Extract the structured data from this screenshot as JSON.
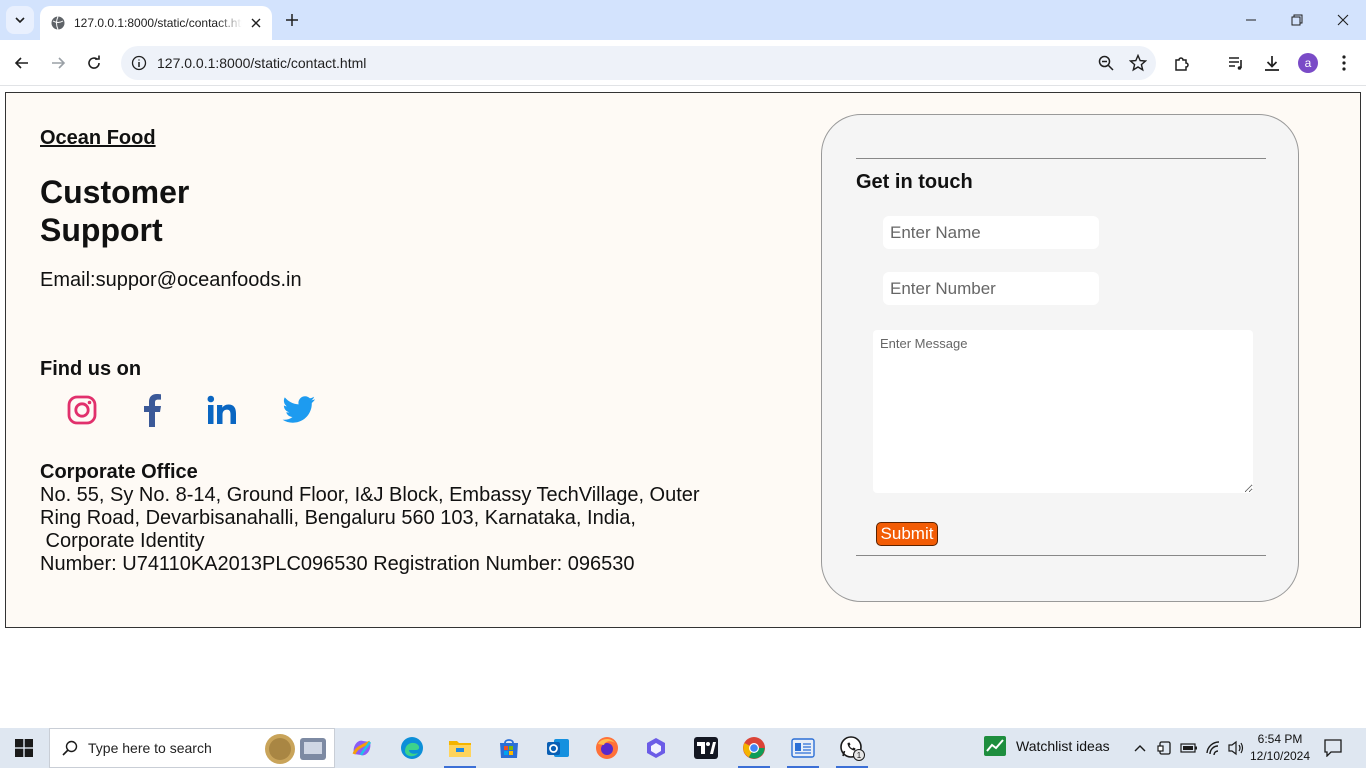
{
  "browser": {
    "tab_title": "127.0.0.1:8000/static/contact.html",
    "url": "127.0.0.1:8000/static/contact.html",
    "profile_initial": "a"
  },
  "page": {
    "brand": "Ocean Food",
    "title": "Customer Support",
    "email": "Email:suppor@oceanfoods.in",
    "find_us": "Find us on",
    "social": [
      "instagram",
      "facebook",
      "linkedin",
      "twitter"
    ],
    "office_heading": "Corporate Office",
    "office_address": "No. 55, Sy No. 8-14, Ground Floor, I&J Block, Embassy TechVillage, Outer Ring Road, Devarbisanahalli, Bengaluru 560 103, Karnataka, India,",
    "office_registration_1": " Corporate Identity",
    "office_registration_2": "Number: U74110KA2013PLC096530 Registration Number: 096530"
  },
  "contact_form": {
    "title": "Get in touch",
    "name_placeholder": "Enter Name",
    "number_placeholder": "Enter Number",
    "message_placeholder": "Enter Message",
    "submit_label": "Submit"
  },
  "taskbar": {
    "search_placeholder": "Type here to search",
    "widget_text": "Watchlist ideas",
    "time": "6:54 PM",
    "date": "12/10/2024",
    "whatsapp_badge": "1"
  },
  "colors": {
    "submit": "#f25c05",
    "page_bg": "#fefaf5",
    "card_bg": "#f5f5f5",
    "instagram": "#e1306c",
    "facebook": "#3b5998",
    "linkedin": "#0a66c2",
    "twitter": "#1d9bf0"
  }
}
